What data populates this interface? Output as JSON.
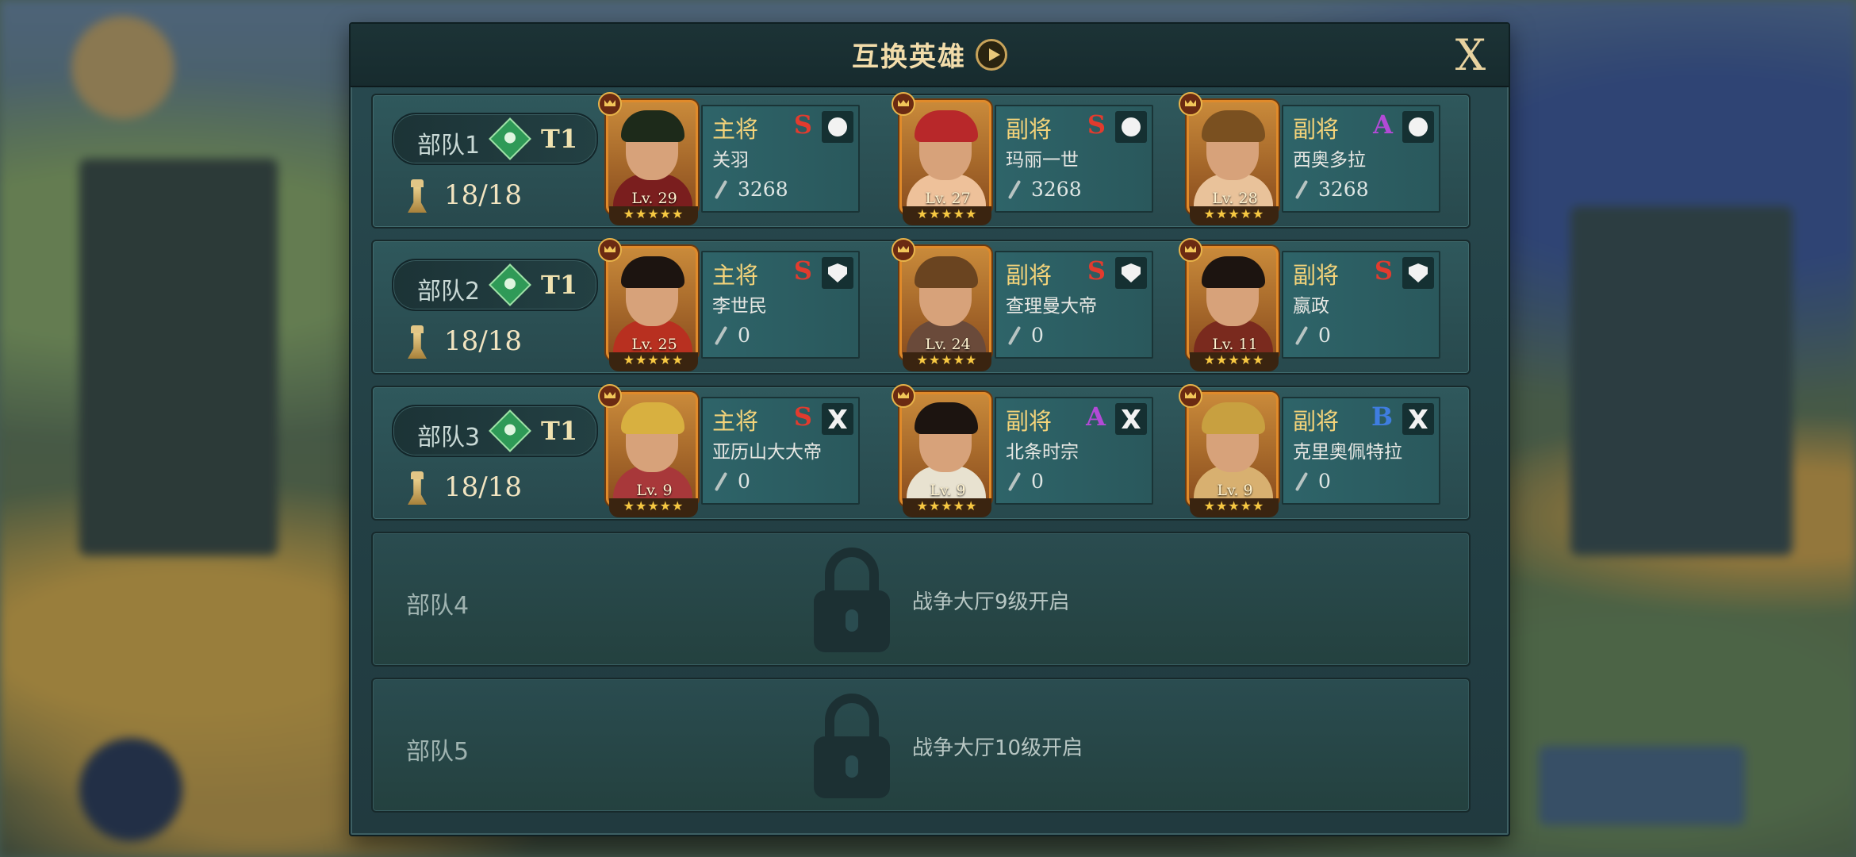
{
  "dialog": {
    "title": "互换英雄",
    "close_label": "X"
  },
  "squads": [
    {
      "name": "部队1",
      "tier": "T1",
      "troops": "18/18",
      "heroes": [
        {
          "role": "主将",
          "grade": "S",
          "name": "关羽",
          "level": "Lv. 29",
          "power": "3268",
          "type_icon": "cavalry-icon"
        },
        {
          "role": "副将",
          "grade": "S",
          "name": "玛丽一世",
          "level": "Lv. 27",
          "power": "3268",
          "type_icon": "cavalry-icon"
        },
        {
          "role": "副将",
          "grade": "A",
          "name": "西奥多拉",
          "level": "Lv. 28",
          "power": "3268",
          "type_icon": "cavalry-icon"
        }
      ]
    },
    {
      "name": "部队2",
      "tier": "T1",
      "troops": "18/18",
      "heroes": [
        {
          "role": "主将",
          "grade": "S",
          "name": "李世民",
          "level": "Lv. 25",
          "power": "0",
          "type_icon": "infantry-icon"
        },
        {
          "role": "副将",
          "grade": "S",
          "name": "查理曼大帝",
          "level": "Lv. 24",
          "power": "0",
          "type_icon": "infantry-icon"
        },
        {
          "role": "副将",
          "grade": "S",
          "name": "嬴政",
          "level": "Lv. 11",
          "power": "0",
          "type_icon": "infantry-icon"
        }
      ]
    },
    {
      "name": "部队3",
      "tier": "T1",
      "troops": "18/18",
      "heroes": [
        {
          "role": "主将",
          "grade": "S",
          "name": "亚历山大大帝",
          "level": "Lv. 9",
          "power": "0",
          "type_icon": "archer-icon"
        },
        {
          "role": "副将",
          "grade": "A",
          "name": "北条时宗",
          "level": "Lv. 9",
          "power": "0",
          "type_icon": "archer-icon"
        },
        {
          "role": "副将",
          "grade": "B",
          "name": "克里奥佩特拉",
          "level": "Lv. 9",
          "power": "0",
          "type_icon": "archer-icon"
        }
      ]
    }
  ],
  "locked_squads": [
    {
      "name": "部队4",
      "unlock_text": "战争大厅9级开启"
    },
    {
      "name": "部队5",
      "unlock_text": "战争大厅10级开启"
    }
  ],
  "stars": "★★★★★",
  "colors": {
    "panel": "#284a50",
    "title": "#f2dcaa",
    "role": "#f3d37a",
    "grade_S": "#e23b2e",
    "grade_A": "#b24ad6",
    "grade_B": "#3f7de0"
  }
}
